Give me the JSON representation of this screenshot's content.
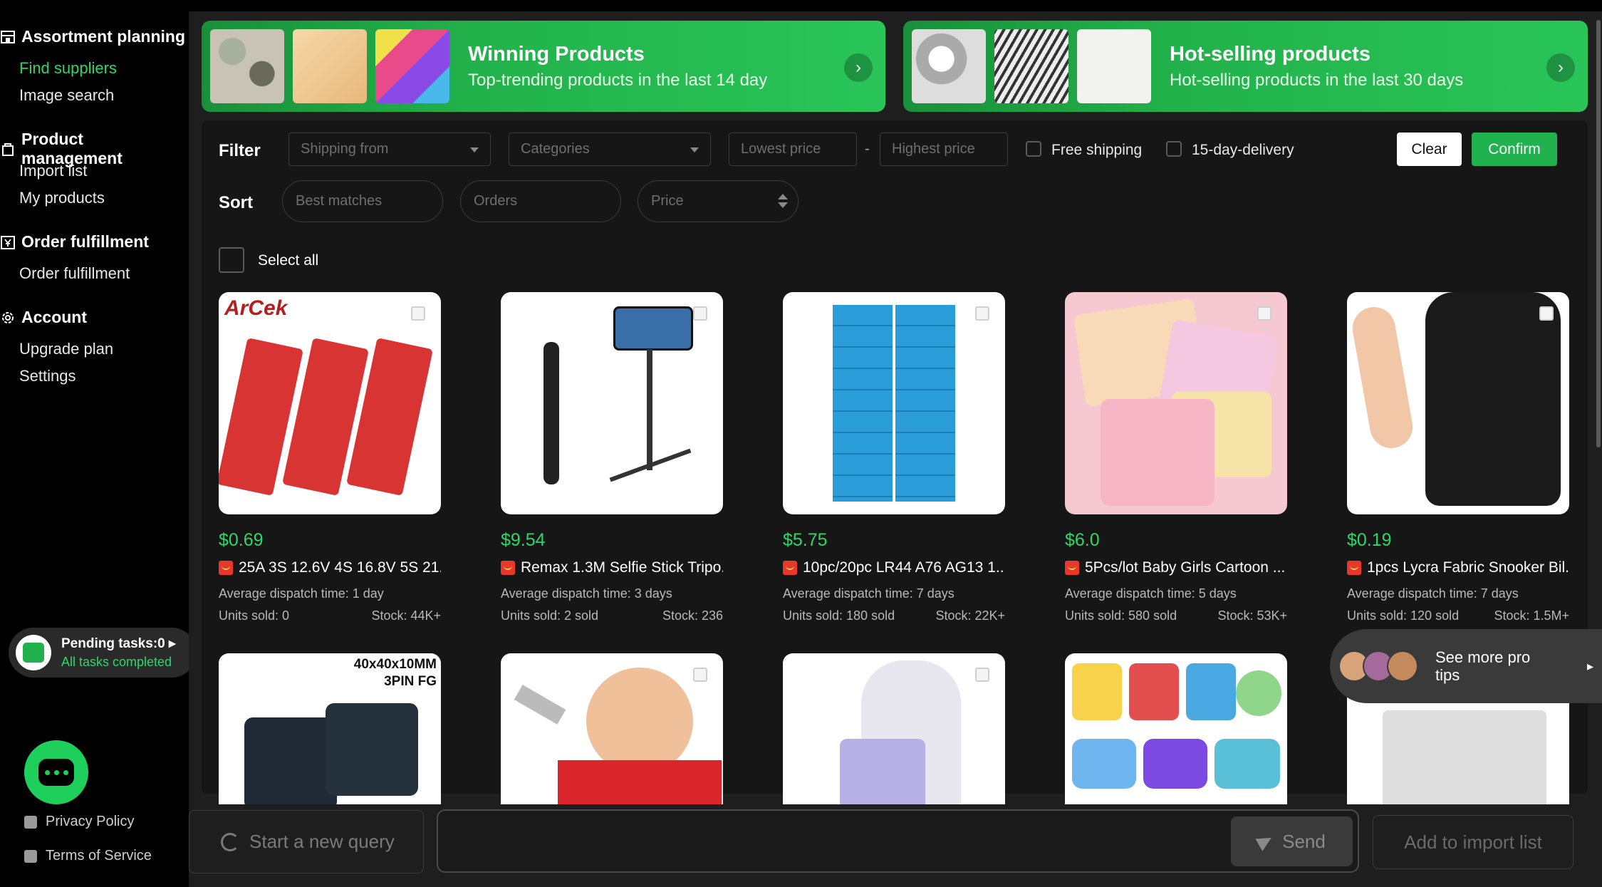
{
  "sidebar": {
    "sections": [
      {
        "title": "Assortment planning",
        "icon": "store-icon",
        "items": [
          {
            "label": "Find suppliers",
            "active": true
          },
          {
            "label": "Image search",
            "active": false
          }
        ]
      },
      {
        "title": "Product management",
        "icon": "bag-icon",
        "items": [
          {
            "label": "Import list"
          },
          {
            "label": "My products"
          }
        ]
      },
      {
        "title": "Order fulfillment",
        "icon": "yen-box-icon",
        "items": [
          {
            "label": "Order fulfillment"
          }
        ]
      },
      {
        "title": "Account",
        "icon": "gear-icon",
        "items": [
          {
            "label": "Upgrade plan"
          },
          {
            "label": "Settings"
          }
        ]
      }
    ],
    "pending": {
      "title": "Pending tasks:0",
      "status": "All tasks completed"
    },
    "footer": {
      "privacy": "Privacy Policy",
      "terms": "Terms of Service"
    }
  },
  "banners": [
    {
      "title": "Winning Products",
      "subtitle": "Top-trending products in the last 14 day"
    },
    {
      "title": "Hot-selling products",
      "subtitle": "Hot-selling products in the last 30 days"
    }
  ],
  "filter": {
    "label": "Filter",
    "shipping_from": "Shipping from",
    "categories": "Categories",
    "lowest_price": "Lowest price",
    "dash": "-",
    "highest_price": "Highest price",
    "free_shipping": "Free shipping",
    "delivery": "15-day-delivery",
    "clear": "Clear",
    "confirm": "Confirm"
  },
  "sort": {
    "label": "Sort",
    "best": "Best matches",
    "orders": "Orders",
    "price": "Price"
  },
  "select_all": "Select all",
  "products": [
    {
      "price": "$0.69",
      "name": "25A 3S 12.6V 4S 16.8V 5S 21...",
      "dispatch": "Average dispatch time: 1 day",
      "units": "Units sold: 0",
      "stock": "Stock: 44K+"
    },
    {
      "price": "$9.54",
      "name": "Remax 1.3M Selfie Stick Tripo...",
      "dispatch": "Average dispatch time: 3 days",
      "units": "Units sold: 2 sold",
      "stock": "Stock: 236"
    },
    {
      "price": "$5.75",
      "name": "10pc/20pc LR44 A76 AG13 1....",
      "dispatch": "Average dispatch time: 7 days",
      "units": "Units sold: 180 sold",
      "stock": "Stock: 22K+"
    },
    {
      "price": "$6.0",
      "name": "5Pcs/lot Baby Girls Cartoon ...",
      "dispatch": "Average dispatch time: 5 days",
      "units": "Units sold: 580 sold",
      "stock": "Stock: 53K+"
    },
    {
      "price": "$0.19",
      "name": "1pcs Lycra Fabric Snooker Bil...",
      "dispatch": "Average dispatch time: 7 days",
      "units": "Units sold: 120 sold",
      "stock": "Stock: 1.5M+"
    }
  ],
  "image_text": {
    "arcek": "ArCek",
    "fan_size": "40x40x10MM",
    "fan_pin": "3PIN FG"
  },
  "protips": {
    "text": "See more pro tips"
  },
  "bottom": {
    "new_query": "Start a new query",
    "send": "Send",
    "add_import": "Add to import list"
  },
  "colors": {
    "accent": "#1fb24f",
    "price": "#2ed66a",
    "background": "#1e1e1e"
  }
}
